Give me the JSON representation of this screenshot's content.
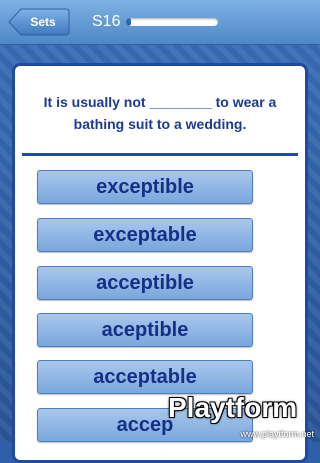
{
  "nav": {
    "back_label": "Sets",
    "set_label": "S16",
    "progress": 0.05
  },
  "question": {
    "text": "It is usually not ________ to wear a bathing suit to a wedding."
  },
  "answers": [
    "exceptible",
    "exceptable",
    "acceptible",
    "aceptible",
    "acceptable",
    "accep"
  ],
  "watermark": {
    "brand": "Playtform",
    "url": "www.playtform.net"
  },
  "colors": {
    "accent": "#1f4aa0",
    "answer_text": "#162f86",
    "topbar": "#5b93d0"
  }
}
